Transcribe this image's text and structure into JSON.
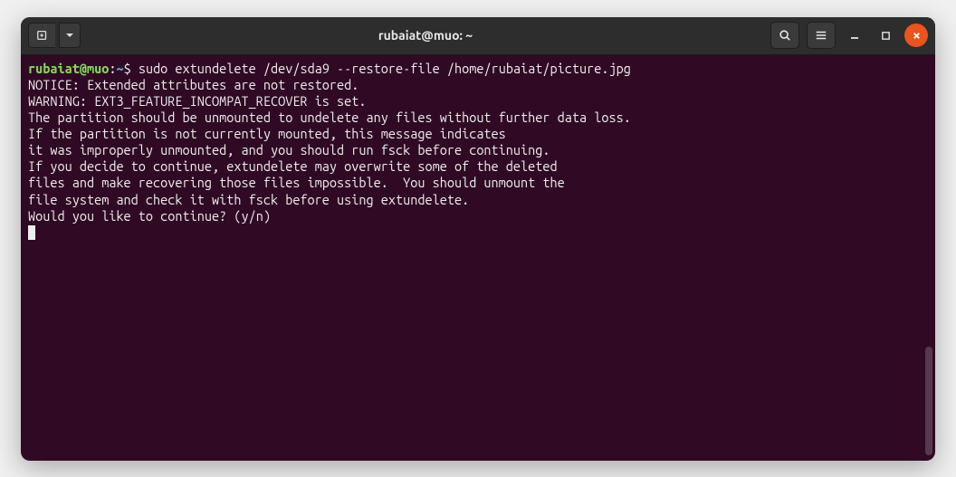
{
  "window": {
    "title": "rubaiat@muo: ~"
  },
  "prompt": {
    "user_host": "rubaiat@muo",
    "colon": ":",
    "path": "~",
    "symbol": "$"
  },
  "command": " sudo extundelete /dev/sda9 --restore-file /home/rubaiat/picture.jpg",
  "output": [
    "NOTICE: Extended attributes are not restored.",
    "WARNING: EXT3_FEATURE_INCOMPAT_RECOVER is set.",
    "The partition should be unmounted to undelete any files without further data loss.",
    "If the partition is not currently mounted, this message indicates",
    "it was improperly unmounted, and you should run fsck before continuing.",
    "If you decide to continue, extundelete may overwrite some of the deleted",
    "files and make recovering those files impossible.  You should unmount the",
    "file system and check it with fsck before using extundelete.",
    "Would you like to continue? (y/n)"
  ]
}
